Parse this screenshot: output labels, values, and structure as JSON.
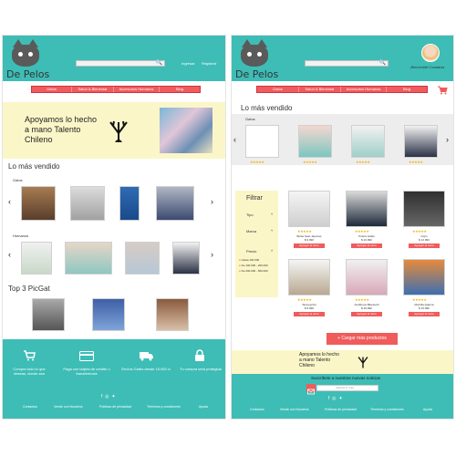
{
  "brand": "De Pelos",
  "search": {
    "icon": "search-icon"
  },
  "header_links": {
    "login": "Ingresar",
    "register": "Registrar"
  },
  "user": {
    "greeting": "¡Bienvenida! Constanza"
  },
  "nav": [
    "Gatos",
    "Salud & Bienestar",
    "Accesorios Humanos",
    "Blog"
  ],
  "banner": {
    "text_line1": "Apoyamos lo hecho",
    "text_line2": "a mano Talento",
    "text_line3": "Chileno"
  },
  "banner_small": {
    "line1": "Apoyamos lo hecho",
    "line2": "a mano Talento",
    "line3": "Chileno"
  },
  "sections": {
    "best_sellers": "Lo más vendido",
    "cats": "Gatos",
    "humans": "Humanos",
    "top3": "Top 3 PicGat"
  },
  "features": [
    {
      "icon": "cart-icon",
      "text": "Compra todo lo que deseas, donde sea"
    },
    {
      "icon": "card-icon",
      "text": "Paga con tarjeta de crédito o transferencia"
    },
    {
      "icon": "truck-icon",
      "text": "Envíos Gratis desde 15.000 cl"
    },
    {
      "icon": "lock-icon",
      "text": "Tu compra será protegida"
    }
  ],
  "footer_links": [
    "Contactos",
    "Vende con Nosotros",
    "Políticas de privacidad",
    "Términos y condiciones",
    "Ayuda"
  ],
  "social": [
    "facebook-icon",
    "instagram-icon",
    "twitter-icon"
  ],
  "filter": {
    "title": "Filtrar",
    "type": "Tipo",
    "brand": "Marca",
    "price": "Precio",
    "price_ranges": [
      "Hasta 100.000",
      "De 100.000 - 200.000",
      "De 200.000 - 500.000"
    ]
  },
  "products": [
    {
      "name": "Bolsa Gato Japonés",
      "price": "$ 9.990"
    },
    {
      "name": "Polera Gatito",
      "price": "$ 10.990"
    },
    {
      "name": "Cojín",
      "price": "$ 12.990"
    },
    {
      "name": "Taza perrito",
      "price": "$ 6.990"
    },
    {
      "name": "Audífonos Bluetooth",
      "price": "$ 29.990"
    },
    {
      "name": "Mochila Gatuna",
      "price": "$ 15.990"
    }
  ],
  "product_button": "Agregar al carro",
  "load_more": "+ Cargar más productos",
  "newsletter": {
    "title": "Suscríbete a nuestras nuevas noticias",
    "placeholder": "Ingresa tu mail"
  },
  "rating": "★★★★★",
  "colors": {
    "teal": "#3dbdb6",
    "coral": "#f05b5b",
    "cream": "#fbf6c8",
    "star": "#f3b415"
  }
}
